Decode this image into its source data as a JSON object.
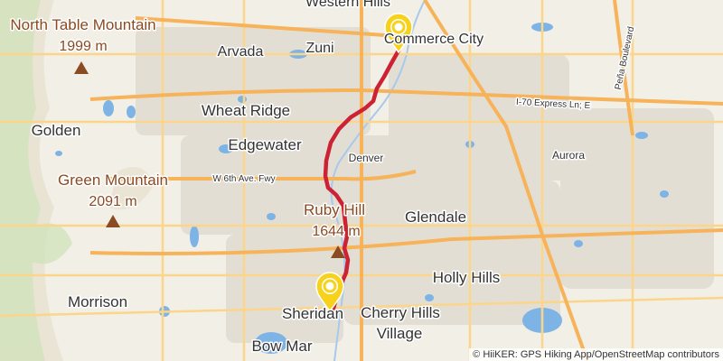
{
  "map": {
    "colors": {
      "background": "#f2efe6",
      "urban": "#e3ded4",
      "park": "#cfe3b8",
      "water": "#7eb3e6",
      "highway": "#f7b35a",
      "major_road": "#fbd58a",
      "route": "#cc2233",
      "start_pin": "#f7d21c",
      "peak_marker": "#8a4a22"
    },
    "cities": [
      {
        "id": "western-hills",
        "name": "Western Hills"
      },
      {
        "id": "commerce-city",
        "name": "Commerce City"
      },
      {
        "id": "arvada",
        "name": "Arvada"
      },
      {
        "id": "zuni",
        "name": "Zuni"
      },
      {
        "id": "wheat-ridge",
        "name": "Wheat Ridge"
      },
      {
        "id": "golden",
        "name": "Golden"
      },
      {
        "id": "edgewater",
        "name": "Edgewater"
      },
      {
        "id": "denver",
        "name": "Denver"
      },
      {
        "id": "aurora",
        "name": "Aurora"
      },
      {
        "id": "glendale",
        "name": "Glendale"
      },
      {
        "id": "holly-hills",
        "name": "Holly Hills"
      },
      {
        "id": "morrison",
        "name": "Morrison"
      },
      {
        "id": "sheridan",
        "name": "Sheridan"
      },
      {
        "id": "cherry-hills",
        "name": "Cherry Hills"
      },
      {
        "id": "village",
        "name": "Village"
      },
      {
        "id": "bow-mar",
        "name": "Bow Mar"
      }
    ],
    "peaks": [
      {
        "id": "north-table",
        "name": "North Table Mountain",
        "elevation": "1999 m"
      },
      {
        "id": "green-mountain",
        "name": "Green Mountain",
        "elevation": "2091 m"
      },
      {
        "id": "ruby-hill",
        "name": "Ruby Hill",
        "elevation": "1644 m"
      }
    ],
    "roads": [
      {
        "id": "i70-express",
        "name": "I-70 Express Ln; E"
      },
      {
        "id": "w6th",
        "name": "W 6th Ave. Fwy"
      },
      {
        "id": "pena",
        "name": "Peña Boulevard"
      }
    ],
    "attribution": "© HiiKER: GPS Hiking App/OpenStreetMap contributors"
  }
}
